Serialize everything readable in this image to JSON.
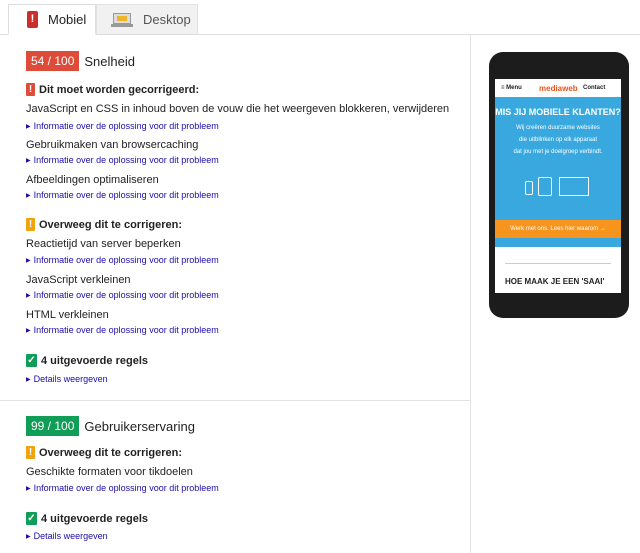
{
  "tabs": [
    {
      "label": "Mobiel",
      "icon": "mobile-phone-icon"
    },
    {
      "label": "Desktop",
      "icon": "laptop-icon"
    }
  ],
  "speed": {
    "score": "54 / 100",
    "title": "Snelheid",
    "must_fix": {
      "heading": "Dit moet worden gecorrigeerd:",
      "rules": [
        {
          "title": "JavaScript en CSS in inhoud boven de vouw die het weergeven blokkeren, verwijderen",
          "link": "Informatie over de oplossing voor dit probleem"
        },
        {
          "title": "Gebruikmaken van browsercaching",
          "link": "Informatie over de oplossing voor dit probleem"
        },
        {
          "title": "Afbeeldingen optimaliseren",
          "link": "Informatie over de oplossing voor dit probleem"
        }
      ]
    },
    "consider": {
      "heading": "Overweeg dit te corrigeren:",
      "rules": [
        {
          "title": "Reactietijd van server beperken",
          "link": "Informatie over de oplossing voor dit probleem"
        },
        {
          "title": "JavaScript verkleinen",
          "link": "Informatie over de oplossing voor dit probleem"
        },
        {
          "title": "HTML verkleinen",
          "link": "Informatie over de oplossing voor dit probleem"
        }
      ]
    },
    "passed": {
      "heading": "4 uitgevoerde regels",
      "link": "Details weergeven"
    }
  },
  "ux": {
    "score": "99 / 100",
    "title": "Gebruikerservaring",
    "consider": {
      "heading": "Overweeg dit te corrigeren:",
      "rules": [
        {
          "title": "Geschikte formaten voor tikdoelen",
          "link": "Informatie over de oplossing voor dit probleem"
        }
      ]
    },
    "passed": {
      "heading": "4 uitgevoerde regels",
      "link": "Details weergeven"
    }
  },
  "preview": {
    "menu": "≡ Menu",
    "logo": "mediaweb",
    "contact": "Contact",
    "headline": "MIS JIJ MOBIELE KLANTEN?",
    "lines": [
      "Wij creëren duurzame websites",
      "die uitblinken op elk apparaat",
      "dat jou met je doelgroep verbindt."
    ],
    "button": "Werk met ons. Lees hier waarom →",
    "bottom": "HOE MAAK JE EEN 'SAAI'"
  },
  "colors": {
    "fail": "#dd4b39",
    "warn": "#f0a30a",
    "pass": "#0f9d58",
    "link": "#1a0dab"
  }
}
